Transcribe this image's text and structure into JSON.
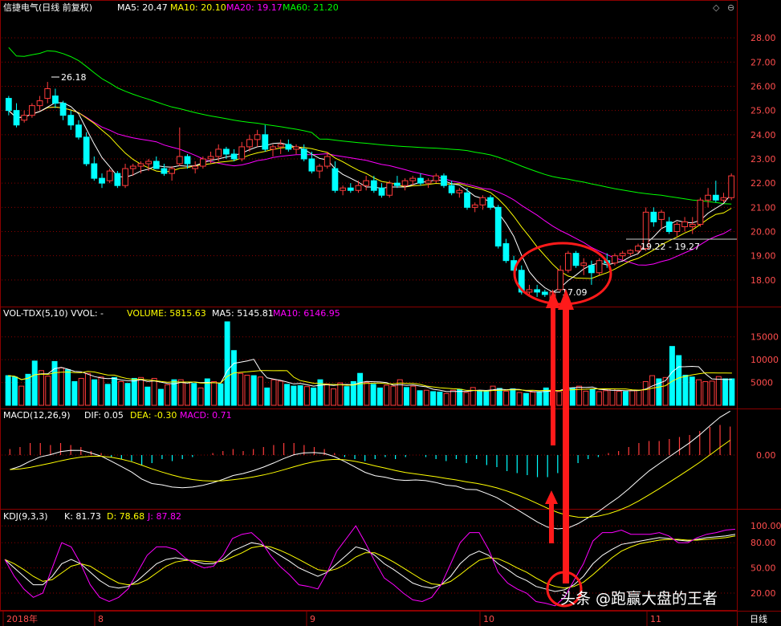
{
  "header": {
    "stock_title": "信捷电气(日线 前复权)",
    "ma5": "MA5: 20.47",
    "ma10": "MA10: 20.10",
    "ma20": "MA20: 19.17",
    "ma60": "MA60: 21.20"
  },
  "volume_panel": {
    "label": "VOL-TDX(5,10) VVOL: -",
    "volume": "VOLUME: 5815.63",
    "ma5": "MA5: 5145.81",
    "ma10": "MA10: 6146.95"
  },
  "macd_panel": {
    "label": "MACD(12,26,9)",
    "dif": "DIF: 0.05",
    "dea": "DEA: -0.30",
    "macd": "MACD: 0.71"
  },
  "kdj_panel": {
    "label": "KDJ(9,3,3)",
    "k": "K: 81.73",
    "d": "D: 78.68",
    "j": "J: 87.82"
  },
  "annotations": {
    "high": "26.18",
    "low": "17.09",
    "range": "19.22 - 19.27"
  },
  "x_axis": {
    "labels": [
      "2018年",
      "8",
      "9",
      "10",
      "11"
    ],
    "period": "日线"
  },
  "watermark": "头条 @跑赢大盘的王者",
  "colors": {
    "up": "#ff3b3b",
    "down": "#00ffff",
    "ma5": "#ffffff",
    "ma10": "#ffff00",
    "ma20": "#ff00ff",
    "ma60": "#00ff00",
    "grid": "#8b0000",
    "axis_text": "#ff4d4d",
    "annotation": "#ff0000"
  },
  "chart_data": [
    {
      "type": "candlestick",
      "title": "信捷电气(日线 前复权)",
      "ylim": [
        17.1,
        28.9
      ],
      "y_ticks": [
        "28.00",
        "27.00",
        "26.00",
        "25.00",
        "24.00",
        "23.00",
        "22.00",
        "21.00",
        "20.00",
        "19.00",
        "18.00"
      ],
      "ohlc": [
        [
          25.5,
          25.6,
          24.8,
          25.0
        ],
        [
          25.0,
          25.3,
          24.3,
          24.4
        ],
        [
          24.6,
          25.0,
          24.5,
          24.8
        ],
        [
          24.8,
          25.3,
          24.7,
          25.2
        ],
        [
          25.2,
          25.6,
          25.0,
          25.4
        ],
        [
          25.5,
          26.18,
          25.3,
          25.9
        ],
        [
          25.6,
          25.9,
          25.1,
          25.3
        ],
        [
          25.3,
          25.4,
          24.6,
          24.8
        ],
        [
          24.8,
          25.0,
          24.2,
          24.4
        ],
        [
          24.4,
          24.6,
          23.8,
          23.9
        ],
        [
          23.9,
          24.1,
          22.7,
          22.8
        ],
        [
          22.8,
          23.1,
          22.1,
          22.2
        ],
        [
          22.2,
          22.4,
          21.8,
          22.0
        ],
        [
          22.1,
          22.6,
          22.0,
          22.5
        ],
        [
          22.4,
          22.5,
          21.8,
          21.9
        ],
        [
          21.9,
          22.8,
          21.8,
          22.6
        ],
        [
          22.6,
          22.8,
          22.3,
          22.7
        ],
        [
          22.7,
          22.9,
          22.4,
          22.8
        ],
        [
          22.8,
          23.0,
          22.5,
          22.9
        ],
        [
          22.9,
          23.1,
          22.7,
          22.6
        ],
        [
          22.6,
          22.8,
          22.3,
          22.4
        ],
        [
          22.4,
          22.7,
          22.1,
          22.6
        ],
        [
          22.8,
          24.3,
          22.7,
          23.1
        ],
        [
          23.1,
          23.2,
          22.6,
          22.8
        ],
        [
          22.6,
          22.9,
          22.4,
          22.7
        ],
        [
          22.7,
          23.1,
          22.6,
          23.0
        ],
        [
          23.0,
          23.3,
          22.8,
          23.1
        ],
        [
          23.1,
          23.6,
          22.9,
          23.4
        ],
        [
          23.4,
          23.5,
          23.0,
          23.2
        ],
        [
          23.2,
          23.4,
          22.9,
          23.0
        ],
        [
          23.0,
          23.7,
          22.9,
          23.5
        ],
        [
          23.5,
          24.0,
          23.3,
          23.8
        ],
        [
          23.8,
          24.2,
          23.5,
          24.0
        ],
        [
          24.0,
          24.4,
          23.3,
          23.4
        ],
        [
          23.4,
          23.6,
          23.1,
          23.5
        ],
        [
          23.5,
          23.8,
          23.2,
          23.6
        ],
        [
          23.6,
          23.8,
          23.3,
          23.4
        ],
        [
          23.4,
          23.6,
          23.2,
          23.5
        ],
        [
          23.4,
          23.6,
          22.9,
          23.0
        ],
        [
          23.0,
          23.3,
          22.4,
          22.5
        ],
        [
          22.5,
          22.8,
          22.2,
          22.7
        ],
        [
          22.7,
          23.3,
          22.6,
          23.1
        ],
        [
          22.6,
          22.9,
          21.6,
          21.7
        ],
        [
          21.7,
          21.9,
          21.5,
          21.8
        ],
        [
          21.8,
          22.0,
          21.6,
          21.7
        ],
        [
          21.7,
          22.1,
          21.6,
          21.9
        ],
        [
          21.9,
          22.3,
          21.7,
          22.1
        ],
        [
          22.1,
          22.3,
          21.6,
          21.7
        ],
        [
          21.8,
          22.0,
          21.4,
          21.5
        ],
        [
          21.5,
          22.1,
          21.4,
          22.0
        ],
        [
          22.0,
          22.3,
          21.8,
          21.9
        ],
        [
          21.9,
          22.2,
          21.7,
          22.1
        ],
        [
          22.1,
          22.3,
          21.9,
          22.2
        ],
        [
          22.2,
          22.4,
          21.9,
          22.0
        ],
        [
          22.0,
          22.2,
          21.8,
          22.1
        ],
        [
          22.1,
          22.4,
          22.0,
          22.3
        ],
        [
          22.3,
          22.4,
          21.8,
          21.9
        ],
        [
          21.9,
          22.1,
          21.5,
          21.6
        ],
        [
          21.6,
          21.8,
          21.4,
          21.7
        ],
        [
          21.6,
          21.8,
          20.9,
          21.0
        ],
        [
          21.0,
          21.2,
          20.8,
          21.1
        ],
        [
          21.1,
          21.5,
          20.9,
          21.4
        ],
        [
          21.4,
          21.5,
          20.9,
          21.0
        ],
        [
          21.0,
          21.1,
          19.3,
          19.4
        ],
        [
          19.5,
          19.7,
          18.7,
          18.8
        ],
        [
          18.8,
          19.0,
          18.3,
          18.4
        ],
        [
          18.4,
          18.6,
          17.4,
          17.5
        ],
        [
          17.5,
          17.8,
          17.3,
          17.6
        ],
        [
          17.6,
          17.8,
          17.3,
          17.5
        ],
        [
          17.5,
          17.6,
          17.3,
          17.4
        ],
        [
          17.2,
          17.6,
          17.09,
          17.5
        ],
        [
          17.6,
          18.6,
          17.5,
          18.4
        ],
        [
          18.4,
          19.2,
          18.3,
          19.1
        ],
        [
          19.1,
          19.2,
          18.5,
          18.6
        ],
        [
          18.6,
          18.9,
          18.2,
          18.7
        ],
        [
          18.6,
          18.8,
          17.8,
          18.3
        ],
        [
          18.3,
          18.9,
          18.2,
          18.8
        ],
        [
          18.8,
          19.1,
          18.5,
          18.7
        ],
        [
          18.7,
          19.1,
          18.6,
          19.0
        ],
        [
          19.0,
          19.2,
          18.8,
          19.1
        ],
        [
          19.1,
          19.27,
          19.0,
          19.22
        ],
        [
          19.2,
          19.5,
          19.1,
          19.4
        ],
        [
          19.3,
          21.0,
          19.2,
          20.8
        ],
        [
          20.8,
          21.0,
          20.2,
          20.4
        ],
        [
          20.5,
          20.9,
          20.1,
          20.8
        ],
        [
          20.4,
          20.6,
          19.9,
          20.0
        ],
        [
          20.0,
          20.4,
          19.8,
          20.3
        ],
        [
          20.2,
          20.6,
          20.0,
          20.4
        ],
        [
          20.2,
          20.6,
          19.9,
          20.3
        ],
        [
          20.3,
          21.4,
          20.2,
          21.3
        ],
        [
          21.3,
          21.8,
          21.0,
          21.5
        ],
        [
          21.5,
          22.1,
          21.2,
          21.3
        ],
        [
          21.3,
          21.6,
          21.2,
          21.4
        ],
        [
          21.4,
          22.4,
          21.3,
          22.3
        ]
      ]
    },
    {
      "type": "bar",
      "title": "VOL-TDX(5,10)",
      "ylim": [
        0,
        19000
      ],
      "y_ticks": [
        "15000",
        "10000",
        "5000"
      ],
      "values": [
        6500,
        6200,
        4200,
        6800,
        9700,
        7600,
        6400,
        9600,
        8200,
        7800,
        5200,
        5900,
        7000,
        5600,
        6200,
        4600,
        6100,
        5200,
        4800,
        5900,
        6100,
        4000,
        5900,
        3500,
        4500,
        5600,
        5600,
        5100,
        4800,
        3800,
        5800,
        5200,
        4700,
        18300,
        12000,
        7000,
        6600,
        6500,
        6200,
        3800,
        5600,
        5300,
        4600,
        4200,
        4300,
        4100,
        3800,
        5600,
        4700,
        3600,
        4900,
        4100,
        5200,
        7000,
        5000,
        4600,
        3800,
        4400,
        4200,
        5600,
        3900,
        4200,
        3200,
        3300,
        3000,
        2900,
        2600,
        3300,
        3500,
        2800,
        3900,
        3100,
        3000,
        4200,
        3700,
        3100,
        3600,
        2800,
        2600,
        2900,
        3000,
        3800,
        3300,
        3000,
        5400,
        3800,
        4200,
        3100,
        3500,
        3000,
        3200,
        3600,
        3100,
        3000,
        3200,
        3300,
        5200,
        6500,
        5800,
        6100,
        12900,
        10900,
        6600,
        6200,
        5600,
        5200,
        5300,
        6300,
        5800,
        5800
      ],
      "up_down": [
        0,
        0,
        1,
        0,
        0,
        1,
        1,
        0,
        1,
        0,
        0,
        1,
        1,
        0,
        1,
        0,
        0,
        1,
        0,
        0,
        1,
        0,
        1,
        0,
        1,
        0,
        1,
        1,
        0,
        1,
        0,
        1,
        0,
        0,
        0,
        1,
        1,
        0,
        1,
        0,
        1,
        1,
        0,
        0,
        0,
        1,
        0,
        0,
        1,
        1,
        1,
        0,
        0,
        0,
        1,
        0,
        0,
        1,
        1,
        1,
        0,
        1,
        0,
        1,
        0,
        0,
        1,
        1,
        0,
        1,
        1,
        0,
        0,
        1,
        0,
        1,
        0,
        1,
        0,
        1,
        0,
        0,
        1,
        1,
        0,
        0,
        1,
        1,
        0,
        1,
        1,
        1,
        1,
        0,
        1,
        1,
        1,
        1,
        0,
        1,
        0,
        0,
        0,
        0,
        1,
        1,
        1,
        1,
        0,
        0
      ]
    },
    {
      "type": "bar",
      "title": "MACD(12,26,9)",
      "y_ticks": [
        "0.00"
      ],
      "values": [
        0.15,
        0.2,
        0.3,
        0.3,
        0.25,
        0.3,
        0.25,
        0.2,
        0.1,
        0.05,
        -0.05,
        -0.1,
        -0.15,
        -0.25,
        -0.2,
        -0.1,
        -0.15,
        -0.1,
        -0.05,
        0.0,
        0.05,
        0.1,
        0.15,
        0.1,
        0.15,
        0.2,
        0.25,
        0.3,
        0.3,
        0.25,
        0.2,
        0.15,
        0.05,
        -0.05,
        -0.1,
        -0.15,
        -0.1,
        -0.05,
        -0.1,
        -0.05,
        0.0,
        -0.05,
        -0.1,
        -0.15,
        -0.1,
        -0.2,
        -0.1,
        -0.25,
        -0.3,
        -0.4,
        -0.45,
        -0.5,
        -0.55,
        -0.55,
        -0.45,
        -0.35,
        -0.2,
        -0.1,
        -0.05,
        0.05,
        0.1,
        0.2,
        0.3,
        0.35,
        0.35,
        0.4,
        0.45,
        0.5,
        0.6,
        0.7,
        0.75,
        0.71
      ]
    },
    {
      "type": "line",
      "title": "KDJ(9,3,3)",
      "ylim": [
        0,
        105
      ],
      "y_ticks": [
        "100.00",
        "80.00",
        "50.00",
        "20.00"
      ],
      "series": [
        {
          "name": "K",
          "values": [
            60,
            50,
            40,
            30,
            30,
            40,
            55,
            60,
            55,
            45,
            35,
            28,
            26,
            28,
            35,
            45,
            55,
            60,
            62,
            60,
            58,
            55,
            55,
            60,
            70,
            75,
            80,
            78,
            72,
            65,
            58,
            50,
            45,
            40,
            45,
            55,
            65,
            75,
            72,
            65,
            55,
            48,
            40,
            32,
            28,
            26,
            30,
            40,
            55,
            65,
            70,
            65,
            55,
            48,
            40,
            35,
            28,
            25,
            22,
            24,
            30,
            40,
            55,
            65,
            72,
            78,
            80,
            82,
            84,
            86,
            85,
            83,
            82,
            84,
            86,
            87,
            88,
            90
          ]
        },
        {
          "name": "D",
          "values": [
            60,
            55,
            48,
            40,
            34,
            36,
            44,
            52,
            55,
            52,
            45,
            38,
            32,
            30,
            31,
            36,
            44,
            52,
            57,
            59,
            59,
            58,
            57,
            58,
            63,
            68,
            74,
            76,
            75,
            71,
            66,
            60,
            54,
            48,
            46,
            49,
            55,
            63,
            68,
            68,
            63,
            57,
            50,
            43,
            36,
            31,
            30,
            34,
            42,
            51,
            59,
            62,
            61,
            56,
            50,
            45,
            38,
            32,
            28,
            26,
            28,
            33,
            42,
            52,
            62,
            70,
            75,
            79,
            81,
            83,
            84,
            84,
            83,
            83,
            84,
            85,
            86,
            88
          ]
        },
        {
          "name": "J",
          "values": [
            60,
            40,
            25,
            15,
            20,
            50,
            80,
            75,
            55,
            30,
            15,
            10,
            15,
            25,
            45,
            65,
            75,
            75,
            72,
            62,
            55,
            50,
            52,
            65,
            85,
            90,
            92,
            82,
            65,
            52,
            42,
            30,
            28,
            25,
            45,
            70,
            85,
            100,
            80,
            58,
            38,
            30,
            20,
            12,
            10,
            15,
            30,
            55,
            80,
            92,
            92,
            72,
            45,
            32,
            25,
            20,
            10,
            8,
            5,
            15,
            35,
            55,
            82,
            92,
            92,
            95,
            90,
            90,
            90,
            92,
            88,
            80,
            80,
            86,
            90,
            92,
            95,
            96
          ]
        }
      ]
    }
  ]
}
